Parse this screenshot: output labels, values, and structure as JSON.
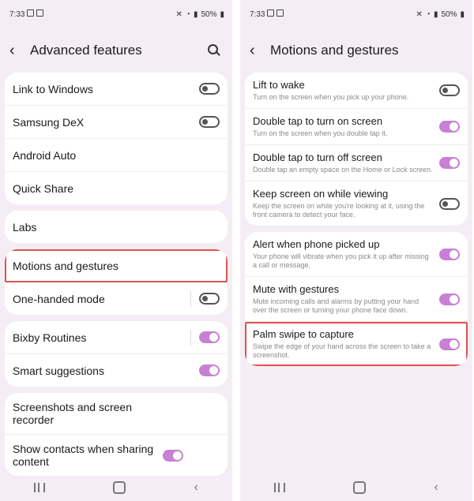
{
  "left": {
    "status": {
      "time": "7:33",
      "battery": "50%"
    },
    "header": {
      "title": "Advanced features"
    },
    "groups": [
      [
        {
          "label": "Link to Windows",
          "toggle": "off"
        },
        {
          "label": "Samsung DeX",
          "toggle": "off"
        },
        {
          "label": "Android Auto"
        },
        {
          "label": "Quick Share"
        }
      ],
      [
        {
          "label": "Labs"
        }
      ],
      [
        {
          "label": "Motions and gestures",
          "highlight": true
        },
        {
          "label": "One-handed mode",
          "toggle": "off",
          "sep": true
        }
      ],
      [
        {
          "label": "Bixby Routines",
          "toggle": "on",
          "sep": true
        },
        {
          "label": "Smart suggestions",
          "toggle": "on"
        }
      ],
      [
        {
          "label": "Screenshots and screen recorder"
        },
        {
          "label": "Show contacts when sharing content",
          "toggle": "on"
        }
      ]
    ]
  },
  "right": {
    "status": {
      "time": "7:33",
      "battery": "50%"
    },
    "header": {
      "title": "Motions and gestures"
    },
    "groups": [
      [
        {
          "title": "Lift to wake",
          "desc": "Turn on the screen when you pick up your phone.",
          "toggle": "off"
        },
        {
          "title": "Double tap to turn on screen",
          "desc": "Turn on the screen when you double tap it.",
          "toggle": "on"
        },
        {
          "title": "Double tap to turn off screen",
          "desc": "Double tap an empty space on the Home or Lock screen.",
          "toggle": "on"
        },
        {
          "title": "Keep screen on while viewing",
          "desc": "Keep the screen on while you're looking at it, using the front camera to detect your face.",
          "toggle": "off"
        }
      ],
      [
        {
          "title": "Alert when phone picked up",
          "desc": "Your phone will vibrate when you pick it up after missing a call or message.",
          "toggle": "on"
        },
        {
          "title": "Mute with gestures",
          "desc": "Mute incoming calls and alarms by putting your hand over the screen or turning your phone face down.",
          "toggle": "on"
        },
        {
          "title": "Palm swipe to capture",
          "desc": "Swipe the edge of your hand across the screen to take a screenshot.",
          "toggle": "on",
          "highlight": true
        }
      ]
    ]
  },
  "colors": {
    "toggle_on": "#c880d4",
    "highlight": "#d9534f",
    "background": "#f4eef4"
  }
}
